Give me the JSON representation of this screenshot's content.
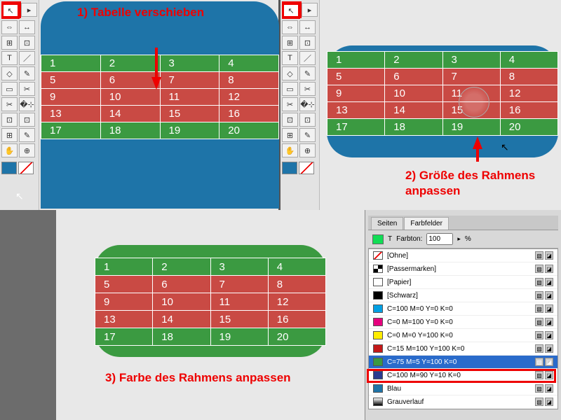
{
  "annotations": {
    "step1": "1) Tabelle verschieben",
    "step2": "2) Größe des Rahmens anpassen",
    "step3": "3) Farbe des Rahmens anpassen"
  },
  "table": {
    "rows": [
      [
        "1",
        "2",
        "3",
        "4"
      ],
      [
        "5",
        "6",
        "7",
        "8"
      ],
      [
        "9",
        "10",
        "11",
        "12"
      ],
      [
        "13",
        "14",
        "15",
        "16"
      ],
      [
        "17",
        "18",
        "19",
        "20"
      ]
    ],
    "row_colors_p1": [
      "g",
      "r",
      "r",
      "r",
      "g"
    ],
    "row_colors_p2": [
      "g",
      "r",
      "r",
      "r",
      "g"
    ],
    "row_colors_p3": [
      "g",
      "r",
      "r",
      "r",
      "g"
    ]
  },
  "tools": {
    "items": [
      [
        "↖",
        "▸"
      ],
      [
        "⇔",
        "↔"
      ],
      [
        "⊞",
        "⊡"
      ],
      [
        "T",
        "／"
      ],
      [
        "◇",
        "✎"
      ],
      [
        "▭",
        "✂"
      ],
      [
        "✂",
        "�⊹"
      ],
      [
        "⊡",
        "⊡"
      ],
      [
        "⊞",
        "✎"
      ],
      [
        "✋",
        "⊕"
      ]
    ]
  },
  "swatch_panel": {
    "tabs": [
      "Seiten",
      "Farbfelder"
    ],
    "tint_label": "Farbton:",
    "tint_value": "100",
    "tint_unit": "%",
    "rows": [
      {
        "name": "[Ohne]",
        "chip": "none"
      },
      {
        "name": "[Passermarken]",
        "chip": "reg"
      },
      {
        "name": "[Papier]",
        "chip": "#ffffff"
      },
      {
        "name": "[Schwarz]",
        "chip": "#000000"
      },
      {
        "name": "C=100 M=0 Y=0 K=0",
        "chip": "#009fe3"
      },
      {
        "name": "C=0 M=100 Y=0 K=0",
        "chip": "#e6007e"
      },
      {
        "name": "C=0 M=0 Y=100 K=0",
        "chip": "#ffed00"
      },
      {
        "name": "C=15 M=100 Y=100 K=0",
        "chip": "#c31818"
      },
      {
        "name": "C=75 M=5 Y=100 K=0",
        "chip": "#3b9a41",
        "selected": true
      },
      {
        "name": "C=100 M=90 Y=10 K=0",
        "chip": "#2a3b8f"
      },
      {
        "name": "Blau",
        "chip": "#1e74a8"
      },
      {
        "name": "Grauverlauf",
        "chip": "linear"
      }
    ]
  }
}
